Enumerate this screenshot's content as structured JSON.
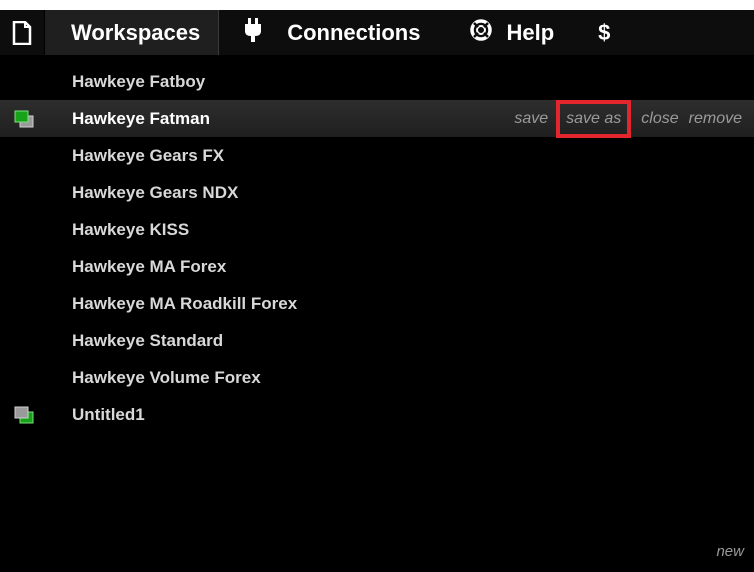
{
  "menubar": {
    "page_icon": "document-icon",
    "tabs": [
      {
        "label": "Workspaces",
        "icon": null
      },
      {
        "label": "Connections",
        "icon": "plug-icon"
      },
      {
        "label": "Help",
        "icon": "lifebuoy-icon"
      },
      {
        "label": "$",
        "icon": null
      }
    ]
  },
  "workspaces": {
    "items": [
      {
        "label": "Hawkeye Fatboy"
      },
      {
        "label": "Hawkeye Fatman",
        "active": true,
        "icon": "workspace-icon-active"
      },
      {
        "label": "Hawkeye Gears FX"
      },
      {
        "label": "Hawkeye Gears NDX"
      },
      {
        "label": "Hawkeye KISS"
      },
      {
        "label": "Hawkeye MA Forex"
      },
      {
        "label": "Hawkeye MA Roadkill Forex"
      },
      {
        "label": "Hawkeye Standard"
      },
      {
        "label": "Hawkeye Volume Forex"
      },
      {
        "label": "Untitled1",
        "icon": "workspace-icon-inactive"
      }
    ],
    "actions": {
      "save": "save",
      "save_as": "save as",
      "close": "close",
      "remove": "remove"
    },
    "new_label": "new"
  },
  "colors": {
    "highlight": "#e3262d",
    "active_green": "#16a31a",
    "inactive_gray": "#9a9a9a"
  }
}
